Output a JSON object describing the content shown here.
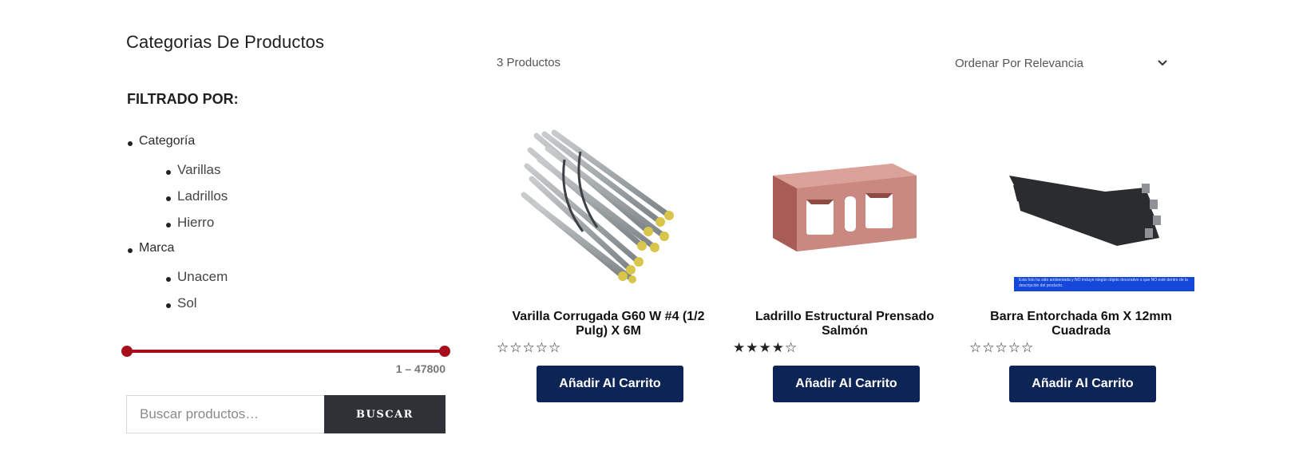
{
  "sidebar": {
    "title": "Categorias De Productos",
    "filter_title": "FILTRADO POR:",
    "groups": [
      {
        "label": "Categoría",
        "items": [
          "Varillas",
          "Ladrillos",
          "Hierro"
        ]
      },
      {
        "label": "Marca",
        "items": [
          "Unacem",
          "Sol"
        ]
      }
    ],
    "price_range": "1 – 47800",
    "price_slider": {
      "min": 1,
      "max": 47800,
      "low": 1,
      "high": 47800
    },
    "search": {
      "placeholder": "Buscar productos…",
      "button_label": "BUSCAR"
    }
  },
  "main": {
    "result_count": "3 Productos",
    "sort": {
      "selected": "Ordenar Por Relevancia"
    }
  },
  "products": [
    {
      "name": "Varilla Corrugada G60 W #4 (1/2 Pulg) X 6M",
      "rating": 0,
      "stars": "☆☆☆☆☆",
      "button": "Añadir Al Carrito",
      "image": "steel-rebar"
    },
    {
      "name": "Ladrillo Estructural Prensado Salmón",
      "rating": 4,
      "stars": "★★★★☆",
      "button": "Añadir Al Carrito",
      "image": "salmon-brick"
    },
    {
      "name": "Barra Entorchada 6m X 12mm Cuadrada",
      "rating": 0,
      "stars": "☆☆☆☆☆",
      "button": "Añadir Al Carrito",
      "image": "twisted-square-bars",
      "banner": "Esta foto ha sido ambientada y NO incluye ningún objeto decorativo o que NO esté dentro de la descripción del producto."
    }
  ],
  "colors": {
    "slider": "#a80d1b",
    "button_primary": "#0c2456",
    "button_search": "#2e3236"
  }
}
